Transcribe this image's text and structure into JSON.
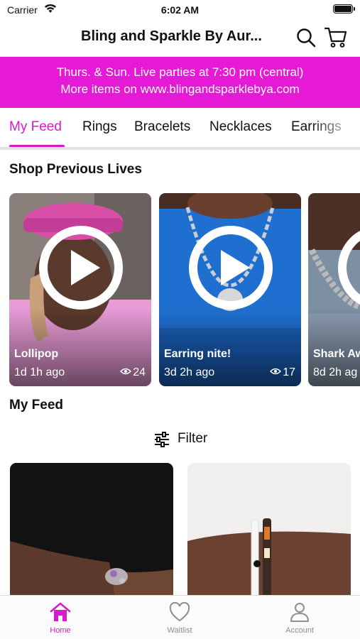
{
  "status_bar": {
    "carrier": "Carrier",
    "time": "6:02 AM"
  },
  "header": {
    "title": "Bling and Sparkle By Aur..."
  },
  "banner": {
    "line1": "Thurs. & Sun. Live parties at 7:30 pm (central)",
    "line2": "More items on www.blingandsparklebya.com",
    "color": "#e619d6"
  },
  "tabs": [
    {
      "label": "My Feed",
      "active": true
    },
    {
      "label": "Rings"
    },
    {
      "label": "Bracelets"
    },
    {
      "label": "Necklaces"
    },
    {
      "label": "Earrings"
    }
  ],
  "accent_color": "#d91ac9",
  "previous_lives": {
    "title": "Shop Previous Lives",
    "items": [
      {
        "title": "Lollipop",
        "age": "1d 1h ago",
        "views": "24"
      },
      {
        "title": "Earring nite!",
        "age": "3d 2h ago",
        "views": "17"
      },
      {
        "title": "Shark Aw",
        "age": "8d 2h ag"
      }
    ]
  },
  "feed": {
    "title": "My Feed",
    "filter_label": "Filter"
  },
  "bottom_nav": [
    {
      "label": "Home",
      "icon": "home-icon",
      "active": true
    },
    {
      "label": "Waitlist",
      "icon": "heart-icon"
    },
    {
      "label": "Account",
      "icon": "person-icon"
    }
  ]
}
